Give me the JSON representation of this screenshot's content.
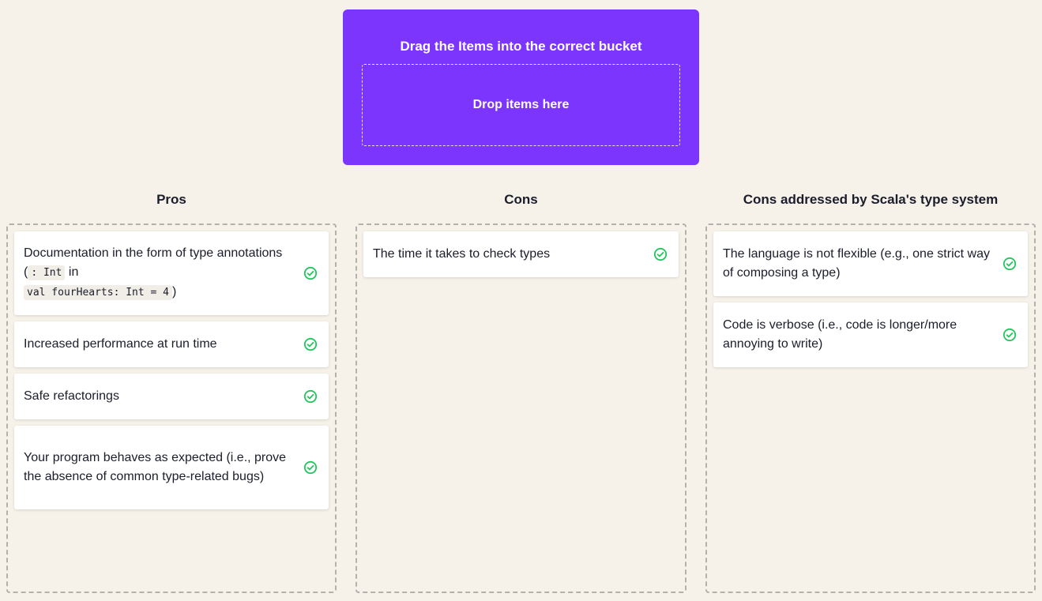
{
  "source": {
    "title": "Drag the Items into the correct bucket",
    "drop_placeholder": "Drop items here"
  },
  "columns": [
    {
      "title": "Pros",
      "items": [
        {
          "parts": [
            "Documentation in the form of type annotations (",
            ": Int",
            " in",
            "val fourHearts: Int = 4",
            ")"
          ]
        },
        {
          "text": "Increased performance at run time"
        },
        {
          "text": "Safe refactorings"
        },
        {
          "text": "Your program behaves as expected (i.e., prove the absence of common type-related bugs)"
        }
      ]
    },
    {
      "title": "Cons",
      "items": [
        {
          "text": "The time it takes to check types"
        }
      ]
    },
    {
      "title": "Cons addressed by Scala's type system",
      "items": [
        {
          "text": "The language is not flexible (e.g., one strict way of composing a type)"
        },
        {
          "text": "Code is verbose (i.e., code is longer/more annoying to write)"
        }
      ]
    }
  ],
  "colors": {
    "background": "#f6f2ea",
    "accent": "#7b35fd",
    "correct": "#22c55e",
    "text": "#1b1d2b"
  },
  "icons": {
    "correct": "check-circle-icon"
  }
}
